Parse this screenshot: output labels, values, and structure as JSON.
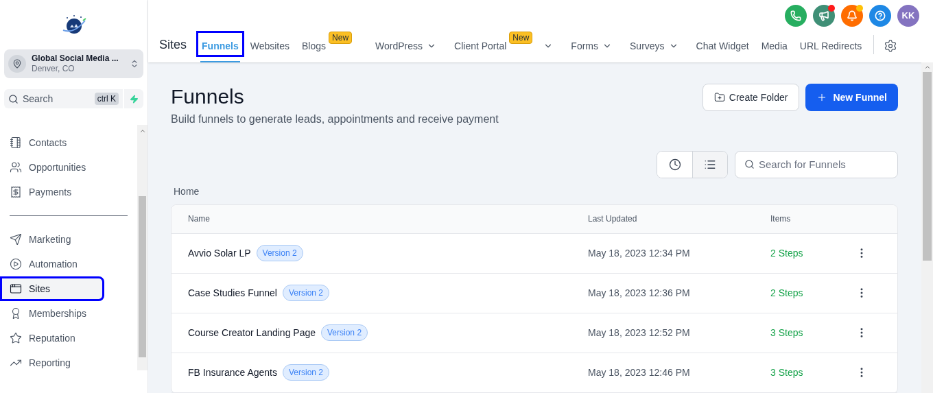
{
  "sidebar": {
    "account": {
      "name": "Global Social Media ...",
      "location": "Denver, CO"
    },
    "search": {
      "placeholder": "Search",
      "shortcut": "ctrl K"
    },
    "groups": [
      [
        {
          "label": "Contacts",
          "selected": false,
          "outlined": false
        },
        {
          "label": "Opportunities",
          "selected": false,
          "outlined": false
        },
        {
          "label": "Payments",
          "selected": false,
          "outlined": false
        }
      ],
      [
        {
          "label": "Marketing",
          "selected": false,
          "outlined": false
        },
        {
          "label": "Automation",
          "selected": false,
          "outlined": false
        },
        {
          "label": "Sites",
          "selected": true,
          "outlined": true
        },
        {
          "label": "Memberships",
          "selected": false,
          "outlined": false
        },
        {
          "label": "Reputation",
          "selected": false,
          "outlined": false
        },
        {
          "label": "Reporting",
          "selected": false,
          "outlined": false
        }
      ]
    ]
  },
  "header": {
    "title": "Sites",
    "tabs": [
      {
        "label": "Funnels",
        "selected": true,
        "outlined": true,
        "dropdown": false
      },
      {
        "label": "Websites",
        "selected": false,
        "outlined": false,
        "dropdown": false
      },
      {
        "label": "Blogs",
        "badge": "New",
        "selected": false,
        "outlined": false,
        "dropdown": false
      },
      {
        "label": "WordPress",
        "selected": false,
        "outlined": false,
        "dropdown": true
      },
      {
        "label": "Client Portal",
        "badge": "New",
        "selected": false,
        "outlined": false,
        "dropdown": true
      },
      {
        "label": "Forms",
        "selected": false,
        "outlined": false,
        "dropdown": true
      },
      {
        "label": "Surveys",
        "selected": false,
        "outlined": false,
        "dropdown": true
      },
      {
        "label": "Chat Widget",
        "selected": false,
        "outlined": false,
        "dropdown": false
      },
      {
        "label": "Media",
        "selected": false,
        "outlined": false,
        "dropdown": false
      },
      {
        "label": "URL Redirects",
        "selected": false,
        "outlined": false,
        "dropdown": false
      }
    ],
    "actions": [
      {
        "kind": "phone",
        "color": "#27ae60",
        "alert": false
      },
      {
        "kind": "megaphone",
        "color": "#3f8f76",
        "alert": true
      },
      {
        "kind": "bell",
        "color": "#ff6d00",
        "alert": true
      },
      {
        "kind": "help",
        "color": "#1e88e5",
        "alert": false
      },
      {
        "kind": "avatar",
        "color": "#8473c0",
        "alert": false,
        "initials": "KK"
      }
    ]
  },
  "page": {
    "title": "Funnels",
    "subtitle": "Build funnels to generate leads, appointments and receive payment",
    "buttons": {
      "create_folder": "Create Folder",
      "new_funnel": "New Funnel"
    },
    "view_toggle": [
      {
        "kind": "recent",
        "selected": false
      },
      {
        "kind": "list",
        "selected": true
      }
    ],
    "search": {
      "placeholder": "Search for Funnels"
    },
    "breadcrumb": "Home",
    "table": {
      "columns": [
        "Name",
        "Last Updated",
        "Items"
      ],
      "rows": [
        {
          "name": "Avvio Solar LP",
          "badge": "Version 2",
          "updated": "May 18, 2023 12:34 PM",
          "items": "2 Steps"
        },
        {
          "name": "Case Studies Funnel",
          "badge": "Version 2",
          "updated": "May 18, 2023 12:36 PM",
          "items": "2 Steps"
        },
        {
          "name": "Course Creator Landing Page",
          "badge": "Version 2",
          "updated": "May 18, 2023 12:52 PM",
          "items": "3 Steps"
        },
        {
          "name": "FB Insurance Agents",
          "badge": "Version 2",
          "updated": "May 18, 2023 12:46 PM",
          "items": "3 Steps"
        }
      ]
    }
  }
}
